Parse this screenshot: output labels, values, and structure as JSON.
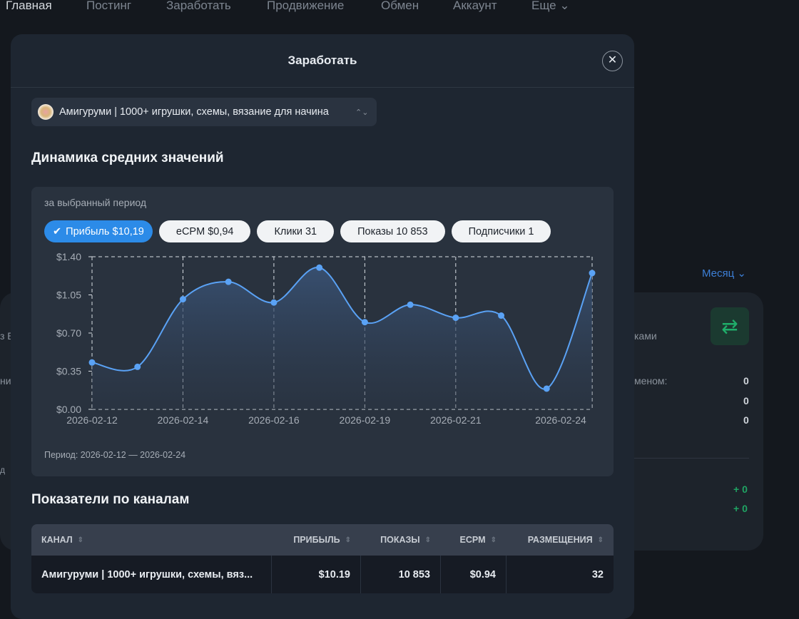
{
  "nav": [
    "Главная",
    "Постинг",
    "Заработать",
    "Продвижение",
    "Обмен",
    "Аккаунт",
    "Еще ⌄"
  ],
  "background": {
    "month": "Месяц ⌄",
    "frag1": "з Е",
    "frag2": "ни",
    "frag3": "д",
    "frag4": "ками",
    "frag5": "меном:",
    "values": [
      "0",
      "0",
      "0"
    ],
    "deltas": [
      "+ 0",
      "+ 0"
    ]
  },
  "modal": {
    "title": "Заработать",
    "close": "✕",
    "channel_select": "Амигуруми | 1000+ игрушки, схемы, вязание для начина",
    "dynamics_title": "Динамика средних значений",
    "period_sub": "за выбранный период",
    "pills": [
      {
        "label": "Прибыль $10,19",
        "active": true
      },
      {
        "label": "eCPM $0,94"
      },
      {
        "label": "Клики 31"
      },
      {
        "label": "Показы 10 853"
      },
      {
        "label": "Подписчики 1"
      }
    ],
    "period": "Период: 2026-02-12 — 2026-02-24",
    "channels_title": "Показатели по каналам",
    "table": {
      "headers": [
        "КАНАЛ",
        "ПРИБЫЛЬ",
        "ПОКАЗЫ",
        "ECPM",
        "РАЗМЕЩЕНИЯ"
      ],
      "rows": [
        [
          "Амигуруми | 1000+ игрушки, схемы, вяз...",
          "$10.19",
          "10 853",
          "$0.94",
          "32"
        ]
      ]
    }
  },
  "chart_data": {
    "type": "area",
    "title": "Прибыль",
    "ylim": [
      0,
      1.4
    ],
    "yticks": [
      "$0.00",
      "$0.35",
      "$0.70",
      "$1.05",
      "$1.40"
    ],
    "x": [
      "2026-02-12",
      "2026-02-13",
      "2026-02-14",
      "2026-02-15",
      "2026-02-16",
      "2026-02-17",
      "2026-02-19",
      "2026-02-20",
      "2026-02-21",
      "2026-02-22",
      "2026-02-23",
      "2026-02-24"
    ],
    "values": [
      0.43,
      0.39,
      1.01,
      1.17,
      0.98,
      1.3,
      0.8,
      0.96,
      0.84,
      0.86,
      0.19,
      1.25
    ],
    "xticks": [
      "2026-02-12",
      "2026-02-14",
      "2026-02-16",
      "2026-02-19",
      "2026-02-21",
      "2026-02-24"
    ],
    "color": "#5aa2f5",
    "grid": true
  }
}
